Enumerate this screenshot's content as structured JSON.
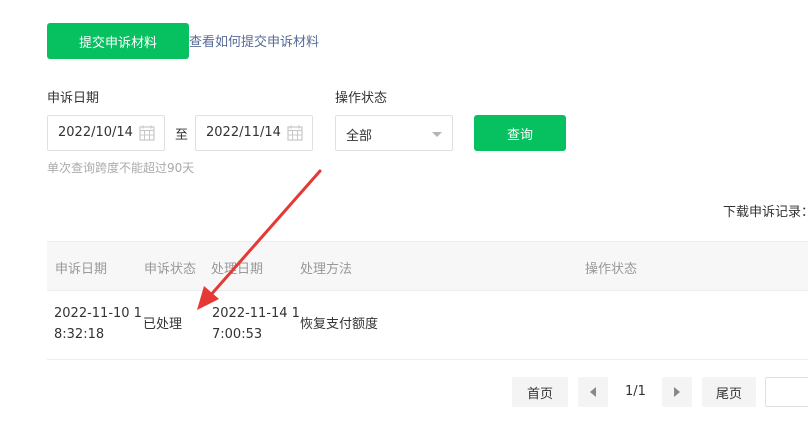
{
  "top": {
    "submit_button": "提交申诉材料",
    "help_link": "查看如何提交申诉材料"
  },
  "filters": {
    "date_label": "申诉日期",
    "start_date": "2022/10/14",
    "separator": "至",
    "end_date": "2022/11/14",
    "status_label": "操作状态",
    "status_selected": "全部",
    "query_button": "查询",
    "hint": "单次查询跨度不能超过90天"
  },
  "download": {
    "label": "下载申诉记录："
  },
  "table": {
    "headers": [
      "申诉日期",
      "申诉状态",
      "处理日期",
      "处理方法",
      "操作状态"
    ],
    "rows": [
      {
        "appeal_date_line1": "2022-11-10 1",
        "appeal_date_line2": "8:32:18",
        "status": "已处理",
        "process_date_line1": "2022-11-14 1",
        "process_date_line2": "7:00:53",
        "method": "恢复支付额度"
      }
    ]
  },
  "pagination": {
    "first": "首页",
    "page_info": "1/1",
    "last": "尾页"
  },
  "colors": {
    "accent_green": "#07c160",
    "link_blue": "#576b95",
    "annotation_arrow": "#e53935"
  }
}
